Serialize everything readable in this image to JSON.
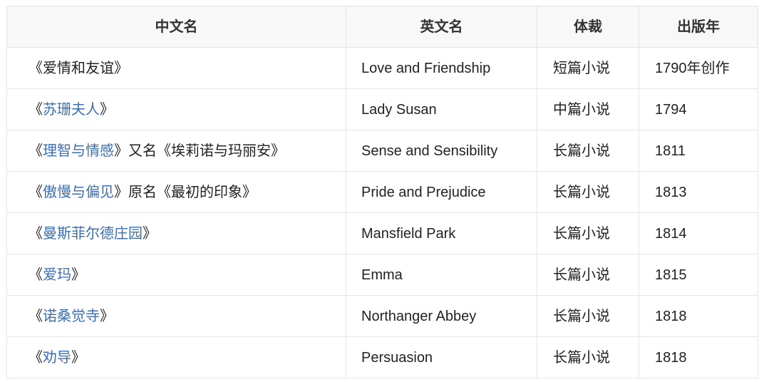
{
  "table": {
    "columns": [
      {
        "key": "cn",
        "label": "中文名"
      },
      {
        "key": "en",
        "label": "英文名"
      },
      {
        "key": "genre",
        "label": "体裁"
      },
      {
        "key": "year",
        "label": "出版年"
      }
    ],
    "colors": {
      "link": "#3c6eb4",
      "text": "#222222",
      "header_bg": "#f8f8f8",
      "header_text": "#333333",
      "border": "#e3e3e3"
    },
    "rows": [
      {
        "cn_full": "《爱情和友谊》",
        "cn_open_bracket": "《",
        "cn_link": "爱情和友谊",
        "cn_close_bracket": "》",
        "cn_suffix": "",
        "cn_is_link": false,
        "en": "Love and Friendship",
        "genre": "短篇小说",
        "year": "1790年创作"
      },
      {
        "cn_full": "《苏珊夫人》",
        "cn_open_bracket": "《",
        "cn_link": "苏珊夫人",
        "cn_close_bracket": "》",
        "cn_suffix": "",
        "cn_is_link": true,
        "en": "Lady Susan",
        "genre": "中篇小说",
        "year": "1794"
      },
      {
        "cn_full": "《理智与情感》又名《埃莉诺与玛丽安》",
        "cn_open_bracket": "《",
        "cn_link": "理智与情感",
        "cn_close_bracket": "》",
        "cn_suffix": "又名《埃莉诺与玛丽安》",
        "cn_is_link": true,
        "en": "Sense and Sensibility",
        "genre": "长篇小说",
        "year": "1811"
      },
      {
        "cn_full": "《傲慢与偏见》原名《最初的印象》",
        "cn_open_bracket": "《",
        "cn_link": "傲慢与偏见",
        "cn_close_bracket": "》",
        "cn_suffix": "原名《最初的印象》",
        "cn_is_link": true,
        "en": "Pride and Prejudice",
        "genre": "长篇小说",
        "year": "1813"
      },
      {
        "cn_full": "《曼斯菲尔德庄园》",
        "cn_open_bracket": "《",
        "cn_link": "曼斯菲尔德庄园",
        "cn_close_bracket": "》",
        "cn_suffix": "",
        "cn_is_link": true,
        "en": "Mansfield Park",
        "genre": "长篇小说",
        "year": "1814"
      },
      {
        "cn_full": "《爱玛》",
        "cn_open_bracket": "《",
        "cn_link": "爱玛",
        "cn_close_bracket": "》",
        "cn_suffix": "",
        "cn_is_link": true,
        "en": "Emma",
        "genre": "长篇小说",
        "year": "1815"
      },
      {
        "cn_full": "《诺桑觉寺》",
        "cn_open_bracket": "《",
        "cn_link": "诺桑觉寺",
        "cn_close_bracket": "》",
        "cn_suffix": "",
        "cn_is_link": true,
        "en": "Northanger Abbey",
        "genre": "长篇小说",
        "year": "1818"
      },
      {
        "cn_full": "《劝导》",
        "cn_open_bracket": "《",
        "cn_link": "劝导",
        "cn_close_bracket": "》",
        "cn_suffix": "",
        "cn_is_link": true,
        "en": "Persuasion",
        "genre": "长篇小说",
        "year": "1818"
      }
    ]
  }
}
